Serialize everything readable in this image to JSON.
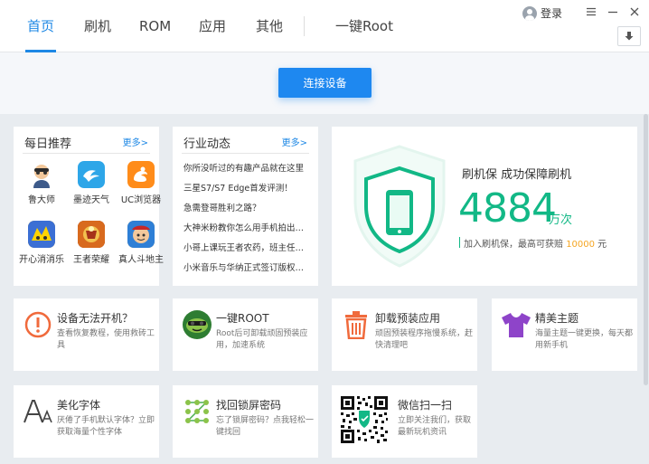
{
  "nav": {
    "tabs": [
      {
        "label": "首页",
        "active": true
      },
      {
        "label": "刷机"
      },
      {
        "label": "ROM"
      },
      {
        "label": "应用"
      },
      {
        "label": "其他"
      },
      {
        "label": "一键Root"
      }
    ]
  },
  "header": {
    "login_label": "登录",
    "icons": [
      "user-icon",
      "menu-icon",
      "minimize-icon",
      "close-icon",
      "download-icon"
    ]
  },
  "device": {
    "connect_label": "连接设备"
  },
  "daily": {
    "title": "每日推荐",
    "more": "更多>",
    "apps": [
      {
        "name": "鲁大师",
        "icon": "ludashi-icon"
      },
      {
        "name": "墨迹天气",
        "icon": "moji-weather-icon"
      },
      {
        "name": "UC浏览器",
        "icon": "uc-browser-icon"
      },
      {
        "name": "开心消消乐",
        "icon": "happy-match-icon"
      },
      {
        "name": "王者荣耀",
        "icon": "honor-of-kings-icon"
      },
      {
        "name": "真人斗地主",
        "icon": "dou-dizhu-icon"
      }
    ]
  },
  "industry": {
    "title": "行业动态",
    "more": "更多>",
    "items": [
      "你所没听过的有趣产品就在这里",
      "三星S7/S7 Edge首发评测！",
      "急需登哥胜利之路？",
      "大神米粉教你怎么用手机拍出…",
      "小哥上课玩王者农药，班主任…",
      "小米音乐与华纳正式签订版权…"
    ]
  },
  "protect": {
    "title": "刷机保   成功保障刷机",
    "count": "4884",
    "unit": "万次",
    "sub_prefix": "加入刷机保，最高可获赔 ",
    "sub_amount": "10000",
    "sub_suffix": " 元",
    "colors": {
      "accent": "#12b886",
      "highlight": "#f5a623"
    }
  },
  "tools": [
    {
      "title": "设备无法开机？",
      "desc": "查看恢复教程，使用救砖工具",
      "icon": "alert-circle-icon"
    },
    {
      "title": "一键ROOT",
      "desc": "Root后可卸载顽固预装应用，加速系统",
      "icon": "root-android-icon"
    },
    {
      "title": "卸载预装应用",
      "desc": "顽固预装程序拖慢系统，赶快清理吧",
      "icon": "trash-icon"
    },
    {
      "title": "精美主题",
      "desc": "海量主题一键更换，每天都用新手机",
      "icon": "tshirt-icon"
    },
    {
      "title": "美化字体",
      "desc": "厌倦了手机默认字体？立即获取海量个性字体",
      "icon": "font-icon"
    },
    {
      "title": "找回锁屏密码",
      "desc": "忘了锁屏密码？点我轻松一键找回",
      "icon": "pattern-lock-icon"
    },
    {
      "title": "微信扫一扫",
      "desc": "立即关注我们，获取最新玩机资讯",
      "icon": "qr-code-icon"
    }
  ],
  "colors": {
    "brand": "#1e88e5",
    "background": "#e8ecf0"
  }
}
